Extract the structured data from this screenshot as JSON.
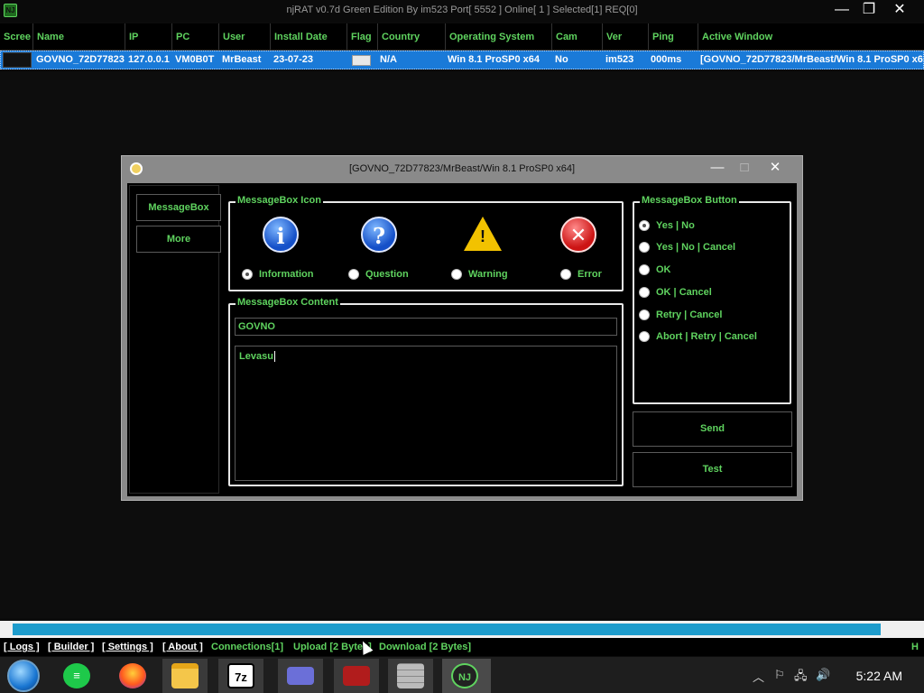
{
  "window": {
    "title": "njRAT v0.7d Green Edition By im523    Port[ 5552 ]    Online[ 1 ]    Selected[1] REQ[0]",
    "minimize_glyph": "—",
    "maximize_glyph": "❐",
    "close_glyph": "✕"
  },
  "table": {
    "columns": [
      "Scree",
      "Name",
      "IP",
      "PC",
      "User",
      "Install Date",
      "Flag",
      "Country",
      "Operating System",
      "Cam",
      "Ver",
      "Ping",
      "Active Window"
    ],
    "rows": [
      {
        "name": "GOVNO_72D77823",
        "ip": "127.0.0.1",
        "pc": "VM0B0T",
        "user": "MrBeast",
        "install_date": "23-07-23",
        "country": "N/A",
        "os": "Win 8.1 ProSP0 x64",
        "cam": "No",
        "ver": "im523",
        "ping": "000ms",
        "active_window": "[GOVNO_72D77823/MrBeast/Win 8.1 ProSP0 x64]"
      }
    ]
  },
  "dialog": {
    "title": "[GOVNO_72D77823/MrBeast/Win 8.1 ProSP0 x64]",
    "sidebar": [
      "MessageBox",
      "More"
    ],
    "icon_group": {
      "label": "MessageBox Icon",
      "options": [
        {
          "label": "Information",
          "icon": "information-icon",
          "checked": true
        },
        {
          "label": "Question",
          "icon": "question-icon",
          "checked": false
        },
        {
          "label": "Warning",
          "icon": "warning-icon",
          "checked": false
        },
        {
          "label": "Error",
          "icon": "error-icon",
          "checked": false
        }
      ]
    },
    "content_group": {
      "label": "MessageBox Content",
      "title_value": "GOVNO",
      "body_value": "Levasu"
    },
    "button_group": {
      "label": "MessageBox Button",
      "options": [
        {
          "label": "Yes | No",
          "checked": true
        },
        {
          "label": "Yes | No | Cancel",
          "checked": false
        },
        {
          "label": "OK",
          "checked": false
        },
        {
          "label": "OK | Cancel",
          "checked": false
        },
        {
          "label": "Retry | Cancel",
          "checked": false
        },
        {
          "label": "Abort | Retry | Cancel",
          "checked": false
        }
      ]
    },
    "send_label": "Send",
    "test_label": "Test"
  },
  "progress": {
    "fraction": 0.952
  },
  "statusbar": {
    "logs": "[ Logs ]",
    "builder": "[ Builder ]",
    "settings": "[ Settings ]",
    "about": "[ About ]",
    "connections": "Connections[1]",
    "upload": "Upload [2 Bytes]",
    "download": "Download [2 Bytes]",
    "right_mark": "H"
  },
  "taskbar": {
    "apps": [
      "start-orb",
      "notes-app",
      "firefox",
      "file-explorer",
      "7zip",
      "card-app",
      "game-app",
      "firewall-app",
      "njrat"
    ],
    "sevenzip_label": "7z",
    "njrat_label": "NJ",
    "clock": "5:22 AM"
  },
  "colors": {
    "accent": "#5fd35f",
    "selection": "#1a7ad8",
    "progress": "#1e9ccc"
  }
}
